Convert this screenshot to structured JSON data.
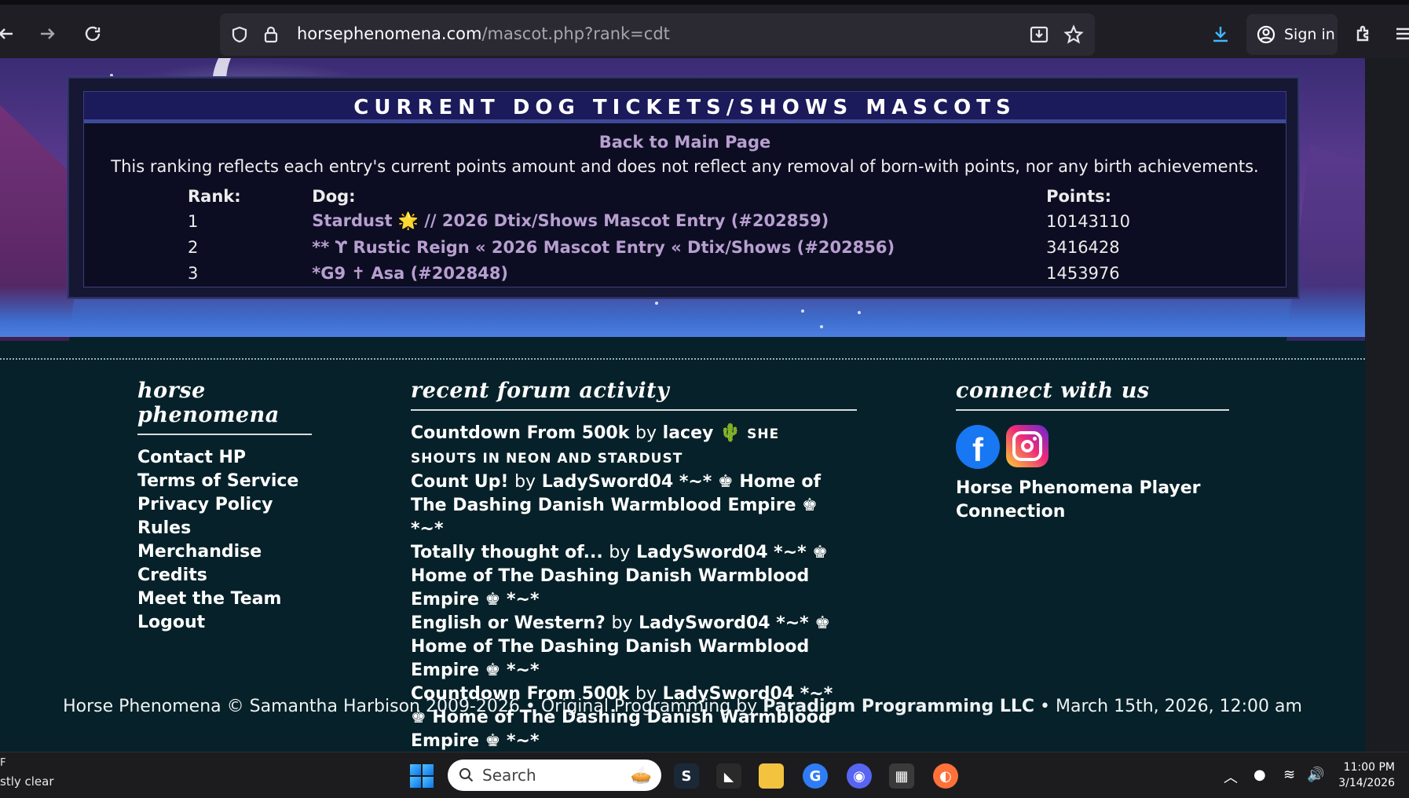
{
  "browser": {
    "url_host": "horsephenomena.com",
    "url_path": "/mascot.php?rank=cdt",
    "sign_in_label": "Sign in"
  },
  "ranking": {
    "title": "CURRENT DOG TICKETS/SHOWS MASCOTS",
    "back_link": "Back to Main Page",
    "disclaimer": "This ranking reflects each entry's current points amount and does not reflect any removal of born-with points, nor any birth achievements.",
    "headers": {
      "rank": "Rank:",
      "dog": "Dog:",
      "points": "Points:"
    },
    "rows": [
      {
        "rank": "1",
        "dog": "Stardust 🌟 // 2026 Dtix/Shows Mascot Entry (#202859)",
        "points": "10143110"
      },
      {
        "rank": "2",
        "dog": "** ϒ Rustic Reign « 2026 Mascot Entry « Dtix/Shows (#202856)",
        "points": "3416428"
      },
      {
        "rank": "3",
        "dog": "*G9 ✝ Asa (#202848)",
        "points": "1453976"
      }
    ]
  },
  "footer": {
    "col1": {
      "heading": "horse phenomena",
      "links": [
        "Contact HP",
        "Terms of Service",
        "Privacy Policy",
        "Rules",
        "Merchandise",
        "Credits",
        "Meet the Team",
        "Logout"
      ]
    },
    "col2": {
      "heading": "recent forum activity",
      "items": [
        {
          "topic": "Countdown From 500k",
          "by": "by",
          "user": "lacey 🌵",
          "tail": "SHE SHOUTS IN NEON AND STARDUST"
        },
        {
          "topic": "Count Up!",
          "by": "by",
          "user": "LadySword04 *~* ♚ Home of The Dashing Danish Warmblood Empire ♚ *~*",
          "tail": ""
        },
        {
          "topic": "Totally thought of...",
          "by": "by",
          "user": "LadySword04 *~* ♚ Home of The Dashing Danish Warmblood Empire ♚ *~*",
          "tail": ""
        },
        {
          "topic": "English or Western?",
          "by": "by",
          "user": "LadySword04 *~* ♚ Home of The Dashing Danish Warmblood Empire ♚ *~*",
          "tail": ""
        },
        {
          "topic": "Countdown From 500k",
          "by": "by",
          "user": "LadySword04 *~* ♚ Home of The Dashing Danish Warmblood Empire ♚ *~*",
          "tail": ""
        }
      ]
    },
    "col3": {
      "heading": "connect with us",
      "link": "Horse Phenomena Player Connection"
    },
    "copyright_pre": "Horse Phenomena © Samantha Harbison 2009-2026  •  Original Programming by ",
    "copyright_company": "Paradigm Programming LLC",
    "copyright_post": "  •  March 15th, 2026, 12:00 am"
  },
  "taskbar": {
    "weather_line1": "F",
    "weather_line2": "stly clear",
    "search_placeholder": "Search",
    "time": "11:00 PM",
    "date": "3/14/2026"
  },
  "colors": {
    "link": "#b89fd0",
    "footer_bg": "#062129",
    "title_bar": "#1b1a5a"
  }
}
